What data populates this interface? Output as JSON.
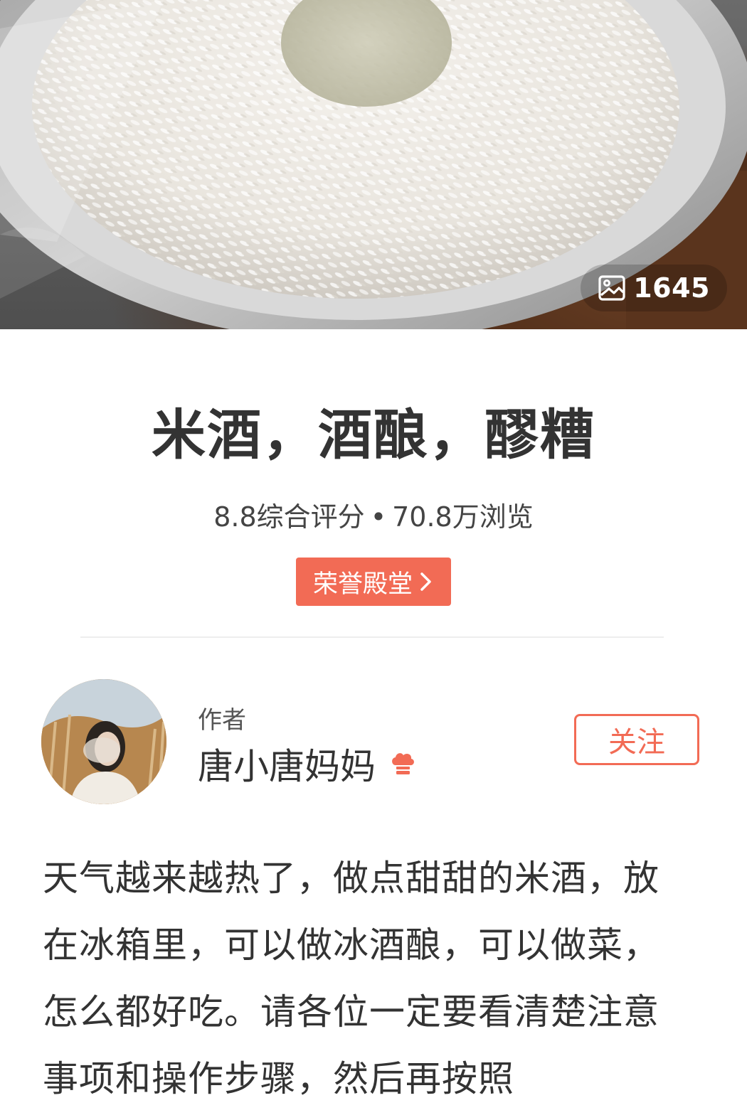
{
  "hero": {
    "photo_count": "1645",
    "photo_icon": "image-icon"
  },
  "recipe": {
    "title": "米酒，酒酿，醪糟",
    "score_text": "8.8综合评分",
    "separator": "•",
    "views_text": "70.8万浏览",
    "badge_label": "荣誉殿堂",
    "badge_icon": "chevron-right-icon"
  },
  "author": {
    "label": "作者",
    "name": "唐小唐妈妈",
    "verified_icon": "chef-hat-icon",
    "follow_label": "关注"
  },
  "description": {
    "text": "天气越来越热了，做点甜甜的米酒，放在冰箱里，可以做冰酒酿，可以做菜，怎么都好吃。请各位一定要看清楚注意事项和操作步骤，然后再按照"
  },
  "colors": {
    "accent": "#f26b55",
    "text_primary": "#333333",
    "text_secondary": "#555555"
  }
}
